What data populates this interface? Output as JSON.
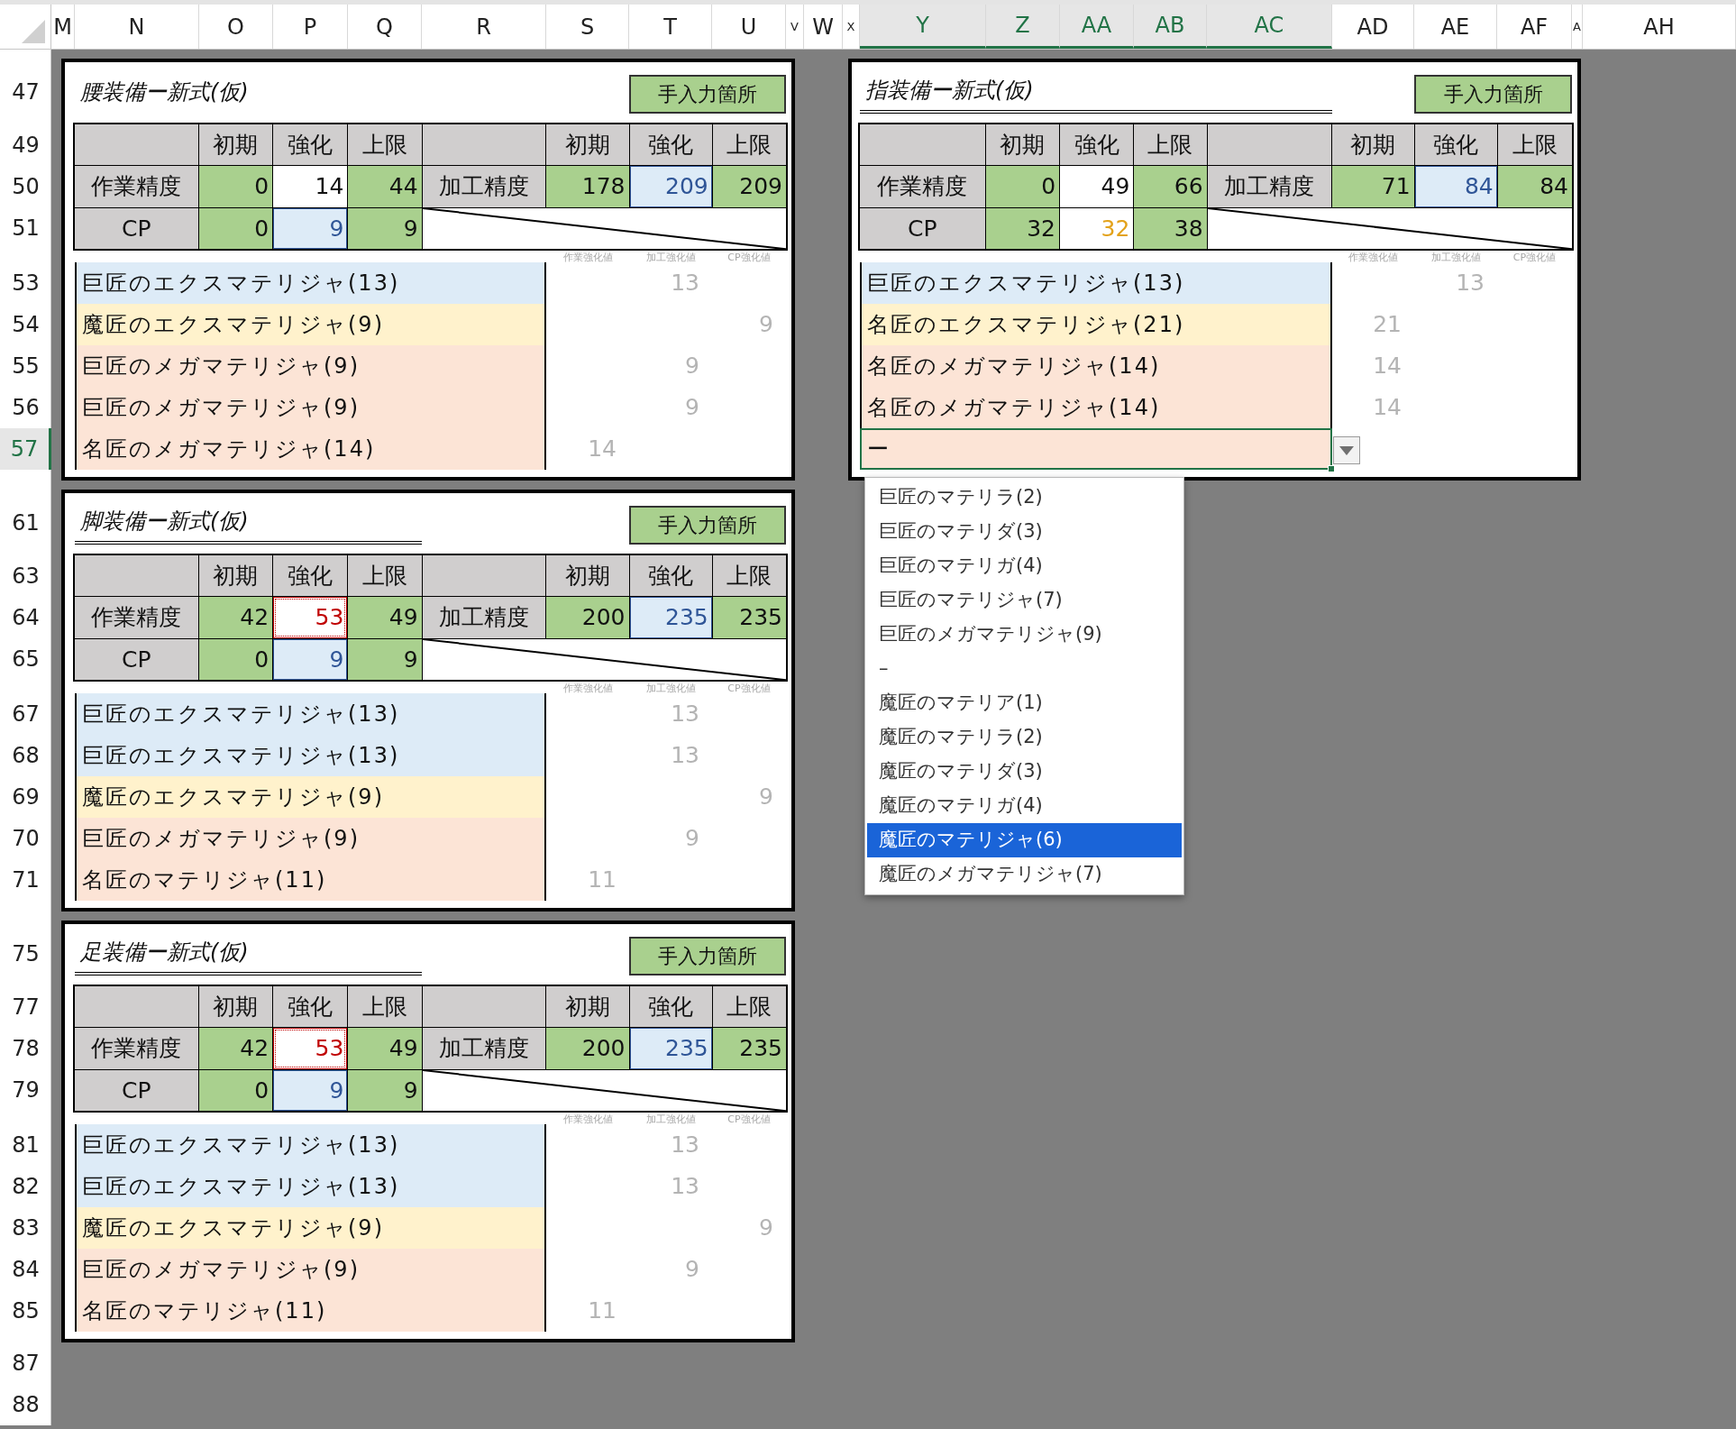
{
  "column_headers": [
    {
      "label": "M",
      "selected": false
    },
    {
      "label": "N",
      "selected": false
    },
    {
      "label": "O",
      "selected": false
    },
    {
      "label": "P",
      "selected": false
    },
    {
      "label": "Q",
      "selected": false
    },
    {
      "label": "R",
      "selected": false
    },
    {
      "label": "S",
      "selected": false
    },
    {
      "label": "T",
      "selected": false
    },
    {
      "label": "U",
      "selected": false
    },
    {
      "label": "V",
      "selected": false
    },
    {
      "label": "W",
      "selected": false
    },
    {
      "label": "X",
      "selected": false
    },
    {
      "label": "Y",
      "selected": true
    },
    {
      "label": "Z",
      "selected": true
    },
    {
      "label": "AA",
      "selected": true
    },
    {
      "label": "AB",
      "selected": true
    },
    {
      "label": "AC",
      "selected": true
    },
    {
      "label": "AD",
      "selected": false
    },
    {
      "label": "AE",
      "selected": false
    },
    {
      "label": "AF",
      "selected": false
    },
    {
      "label": "A",
      "selected": false
    },
    {
      "label": "AH",
      "selected": false
    }
  ],
  "row_headers": [
    {
      "label": "47",
      "selected": false
    },
    {
      "label": "49",
      "selected": false
    },
    {
      "label": "50",
      "selected": false
    },
    {
      "label": "51",
      "selected": false
    },
    {
      "label": "53",
      "selected": false
    },
    {
      "label": "54",
      "selected": false
    },
    {
      "label": "55",
      "selected": false
    },
    {
      "label": "56",
      "selected": false
    },
    {
      "label": "57",
      "selected": true
    },
    {
      "label": "61",
      "selected": false
    },
    {
      "label": "63",
      "selected": false
    },
    {
      "label": "64",
      "selected": false
    },
    {
      "label": "65",
      "selected": false
    },
    {
      "label": "67",
      "selected": false
    },
    {
      "label": "68",
      "selected": false
    },
    {
      "label": "69",
      "selected": false
    },
    {
      "label": "70",
      "selected": false
    },
    {
      "label": "71",
      "selected": false
    },
    {
      "label": "75",
      "selected": false
    },
    {
      "label": "77",
      "selected": false
    },
    {
      "label": "78",
      "selected": false
    },
    {
      "label": "79",
      "selected": false
    },
    {
      "label": "81",
      "selected": false
    },
    {
      "label": "82",
      "selected": false
    },
    {
      "label": "83",
      "selected": false
    },
    {
      "label": "84",
      "selected": false
    },
    {
      "label": "85",
      "selected": false
    },
    {
      "label": "87",
      "selected": false
    },
    {
      "label": "88",
      "selected": false
    }
  ],
  "left_panels": [
    {
      "title": "腰装備ー新式(仮)",
      "underlined": false,
      "legend": "手入力箇所",
      "table": {
        "headers": [
          "初期",
          "強化",
          "上限",
          "初期",
          "強化",
          "上限"
        ],
        "rows": [
          {
            "label": "作業精度",
            "cells": [
              {
                "value": "0",
                "kind": "base"
              },
              {
                "value": "14",
                "kind": "input"
              },
              {
                "value": "44",
                "kind": "base"
              }
            ]
          },
          {
            "label": "加工精度",
            "cells": [
              {
                "value": "178",
                "kind": "base"
              },
              {
                "value": "209",
                "kind": "calc"
              },
              {
                "value": "209",
                "kind": "base"
              }
            ]
          },
          {
            "label": "CP",
            "cells": [
              {
                "value": "0",
                "kind": "base"
              },
              {
                "value": "9",
                "kind": "calc"
              },
              {
                "value": "9",
                "kind": "base"
              }
            ]
          }
        ]
      },
      "captions": [
        "作業強化値",
        "加工強化値",
        "CP強化値"
      ],
      "materials": [
        {
          "text": "巨匠のエクスマテリジャ(13)",
          "color": "#ddebf7",
          "kind": "process",
          "value": "13"
        },
        {
          "text": "魔匠のエクスマテリジャ(9)",
          "color": "#fff2cc",
          "kind": "cp",
          "value": "9"
        },
        {
          "text": "巨匠のメガマテリジャ(9)",
          "color": "#fce4d6",
          "kind": "process",
          "value": "9"
        },
        {
          "text": "巨匠のメガマテリジャ(9)",
          "color": "#fce4d6",
          "kind": "process",
          "value": "9"
        },
        {
          "text": "名匠のメガマテリジャ(14)",
          "color": "#fce4d6",
          "kind": "work",
          "value": "14"
        }
      ]
    },
    {
      "title": "脚装備ー新式(仮)",
      "underlined": true,
      "legend": "手入力箇所",
      "table": {
        "headers": [
          "初期",
          "強化",
          "上限",
          "初期",
          "強化",
          "上限"
        ],
        "rows": [
          {
            "label": "作業精度",
            "cells": [
              {
                "value": "42",
                "kind": "base"
              },
              {
                "value": "53",
                "kind": "over"
              },
              {
                "value": "49",
                "kind": "base"
              }
            ]
          },
          {
            "label": "加工精度",
            "cells": [
              {
                "value": "200",
                "kind": "base"
              },
              {
                "value": "235",
                "kind": "calc"
              },
              {
                "value": "235",
                "kind": "base"
              }
            ]
          },
          {
            "label": "CP",
            "cells": [
              {
                "value": "0",
                "kind": "base"
              },
              {
                "value": "9",
                "kind": "calc"
              },
              {
                "value": "9",
                "kind": "base"
              }
            ]
          }
        ]
      },
      "captions": [
        "作業強化値",
        "加工強化値",
        "CP強化値"
      ],
      "materials": [
        {
          "text": "巨匠のエクスマテリジャ(13)",
          "color": "#ddebf7",
          "kind": "process",
          "value": "13"
        },
        {
          "text": "巨匠のエクスマテリジャ(13)",
          "color": "#ddebf7",
          "kind": "process",
          "value": "13"
        },
        {
          "text": "魔匠のエクスマテリジャ(9)",
          "color": "#fff2cc",
          "kind": "cp",
          "value": "9"
        },
        {
          "text": "巨匠のメガマテリジャ(9)",
          "color": "#fce4d6",
          "kind": "process",
          "value": "9"
        },
        {
          "text": "名匠のマテリジャ(11)",
          "color": "#fce4d6",
          "kind": "work",
          "value": "11"
        }
      ]
    },
    {
      "title": "足装備ー新式(仮)",
      "underlined": true,
      "legend": "手入力箇所",
      "table": {
        "headers": [
          "初期",
          "強化",
          "上限",
          "初期",
          "強化",
          "上限"
        ],
        "rows": [
          {
            "label": "作業精度",
            "cells": [
              {
                "value": "42",
                "kind": "base"
              },
              {
                "value": "53",
                "kind": "over"
              },
              {
                "value": "49",
                "kind": "base"
              }
            ]
          },
          {
            "label": "加工精度",
            "cells": [
              {
                "value": "200",
                "kind": "base"
              },
              {
                "value": "235",
                "kind": "calc"
              },
              {
                "value": "235",
                "kind": "base"
              }
            ]
          },
          {
            "label": "CP",
            "cells": [
              {
                "value": "0",
                "kind": "base"
              },
              {
                "value": "9",
                "kind": "calc"
              },
              {
                "value": "9",
                "kind": "base"
              }
            ]
          }
        ]
      },
      "captions": [
        "作業強化値",
        "加工強化値",
        "CP強化値"
      ],
      "materials": [
        {
          "text": "巨匠のエクスマテリジャ(13)",
          "color": "#ddebf7",
          "kind": "process",
          "value": "13"
        },
        {
          "text": "巨匠のエクスマテリジャ(13)",
          "color": "#ddebf7",
          "kind": "process",
          "value": "13"
        },
        {
          "text": "魔匠のエクスマテリジャ(9)",
          "color": "#fff2cc",
          "kind": "cp",
          "value": "9"
        },
        {
          "text": "巨匠のメガマテリジャ(9)",
          "color": "#fce4d6",
          "kind": "process",
          "value": "9"
        },
        {
          "text": "名匠のマテリジャ(11)",
          "color": "#fce4d6",
          "kind": "work",
          "value": "11"
        }
      ]
    }
  ],
  "right_panels": [
    {
      "title": "指装備ー新式(仮)",
      "underlined": true,
      "legend": "手入力箇所",
      "table": {
        "headers": [
          "初期",
          "強化",
          "上限",
          "初期",
          "強化",
          "上限"
        ],
        "rows": [
          {
            "label": "作業精度",
            "cells": [
              {
                "value": "0",
                "kind": "base"
              },
              {
                "value": "49",
                "kind": "input"
              },
              {
                "value": "66",
                "kind": "base"
              }
            ]
          },
          {
            "label": "加工精度",
            "cells": [
              {
                "value": "71",
                "kind": "base"
              },
              {
                "value": "84",
                "kind": "calc"
              },
              {
                "value": "84",
                "kind": "base"
              }
            ]
          },
          {
            "label": "CP",
            "cells": [
              {
                "value": "32",
                "kind": "base"
              },
              {
                "value": "32",
                "kind": "warn"
              },
              {
                "value": "38",
                "kind": "base"
              }
            ]
          }
        ]
      },
      "captions": [
        "作業強化値",
        "加工強化値",
        "CP強化値"
      ],
      "materials": [
        {
          "text": "巨匠のエクスマテリジャ(13)",
          "color": "#ddebf7",
          "kind": "process",
          "value": "13"
        },
        {
          "text": "名匠のエクスマテリジャ(21)",
          "color": "#fff2cc",
          "kind": "work",
          "value": "21"
        },
        {
          "text": "名匠のメガマテリジャ(14)",
          "color": "#fce4d6",
          "kind": "work",
          "value": "14"
        },
        {
          "text": "名匠のメガマテリジャ(14)",
          "color": "#fce4d6",
          "kind": "work",
          "value": "14"
        },
        {
          "text": "ー",
          "color": "#fce4d6",
          "kind": "dropdown"
        }
      ],
      "dropdown": {
        "options": [
          {
            "label": "巨匠のマテリラ(2)",
            "selected": false
          },
          {
            "label": "巨匠のマテリダ(3)",
            "selected": false
          },
          {
            "label": "巨匠のマテリガ(4)",
            "selected": false
          },
          {
            "label": "巨匠のマテリジャ(7)",
            "selected": false
          },
          {
            "label": "巨匠のメガマテリジャ(9)",
            "selected": false
          },
          {
            "label": "–",
            "selected": false
          },
          {
            "label": "魔匠のマテリア(1)",
            "selected": false
          },
          {
            "label": "魔匠のマテリラ(2)",
            "selected": false
          },
          {
            "label": "魔匠のマテリダ(3)",
            "selected": false
          },
          {
            "label": "魔匠のマテリガ(4)",
            "selected": false
          },
          {
            "label": "魔匠のマテリジャ(6)",
            "selected": true
          },
          {
            "label": "魔匠のメガマテリジャ(7)",
            "selected": false
          }
        ]
      }
    }
  ]
}
